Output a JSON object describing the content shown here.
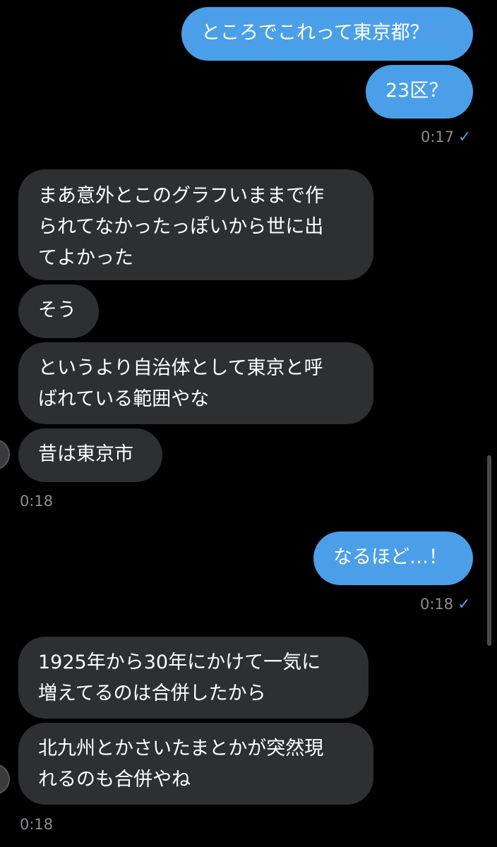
{
  "colors": {
    "background": "#000000",
    "sent_bubble": "#4a9fe8",
    "received_bubble": "#2d2f31",
    "timestamp": "#8a8d91",
    "read_check": "#4a9fe8"
  },
  "messages": [
    {
      "from": "me",
      "text": "ところでこれって東京都？"
    },
    {
      "from": "me",
      "text": "23区？"
    },
    {
      "time": "0:17",
      "status_icon": "check-icon"
    },
    {
      "from": "them",
      "text": "まあ意外とこのグラフいままで作\nられてなかったっぽいから世に出\nてよかった"
    },
    {
      "from": "them",
      "text": "そう"
    },
    {
      "from": "them",
      "text": "というより自治体として東京と呼\nばれている範囲やな"
    },
    {
      "from": "them",
      "text": "昔は東京市"
    },
    {
      "time": "0:18"
    },
    {
      "from": "me",
      "text": "なるほど…！"
    },
    {
      "time": "0:18",
      "status_icon": "check-icon"
    },
    {
      "from": "them",
      "text": "1925年から30年にかけて一気に\n増えてるのは合併したから"
    },
    {
      "from": "them",
      "text": "北九州とかさいたまとかが突然現\nれるのも合併やね"
    },
    {
      "time": "0:18"
    }
  ],
  "check_glyph": "✓"
}
